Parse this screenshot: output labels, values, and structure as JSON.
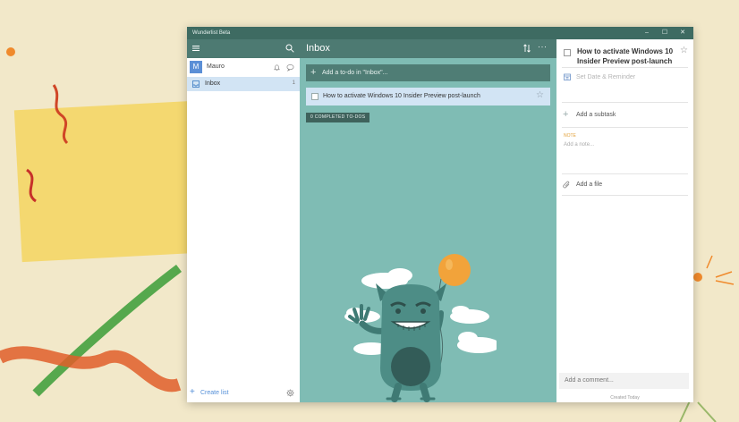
{
  "window": {
    "title": "Wunderlist Beta",
    "controls": {
      "minimize": "–",
      "maximize": "☐",
      "close": "✕"
    }
  },
  "sidebar": {
    "user": {
      "initial": "M",
      "name": "Mauro"
    },
    "lists": [
      {
        "label": "Inbox",
        "count": "1",
        "selected": true
      }
    ],
    "create_list_label": "Create list",
    "icons": [
      "menu-icon",
      "search-icon",
      "bell-icon",
      "chat-icon",
      "inbox-icon",
      "gear-icon"
    ]
  },
  "main": {
    "title": "Inbox",
    "more_label": "···",
    "add_placeholder": "Add a to-do in \"Inbox\"...",
    "todos": [
      {
        "text": "How to activate Windows 10 Insider Preview post-launch",
        "starred": false,
        "done": false
      }
    ],
    "completed_label": "0 COMPLETED TO-DOS"
  },
  "detail": {
    "title": "How to activate Windows 10 Insider Preview post-launch",
    "date_reminder": "Set Date & Reminder",
    "add_subtask": "Add a subtask",
    "note_label": "NOTE",
    "note_placeholder": "Add a note...",
    "add_file": "Add a file",
    "comment_placeholder": "Add a comment...",
    "created": "Created Today"
  },
  "colors": {
    "header": "#4d7a72",
    "background": "#7fbcb4",
    "titlebar": "#3e6b62",
    "selection": "#d2e4f4",
    "accent_blue": "#5590d8",
    "balloon": "#f2a33a"
  }
}
